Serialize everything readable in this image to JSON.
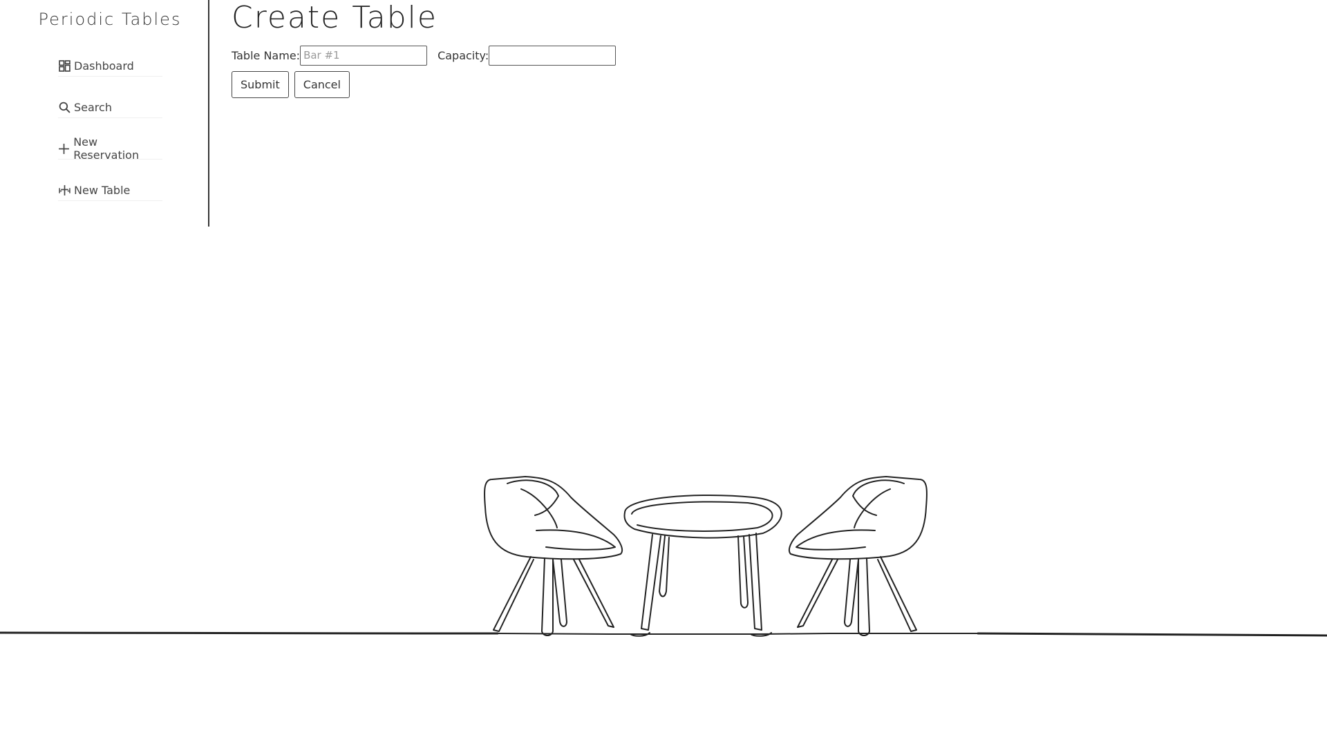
{
  "sidebar": {
    "brand": "Periodic Tables",
    "items": [
      {
        "label": "Dashboard",
        "icon": "dashboard-icon"
      },
      {
        "label": "Search",
        "icon": "search-icon"
      },
      {
        "label": "New Reservation",
        "icon": "plus-icon"
      },
      {
        "label": "New Table",
        "icon": "table-icon"
      }
    ]
  },
  "main": {
    "title": "Create Table",
    "form": {
      "table_name_label": "Table Name:",
      "table_name_value": "",
      "table_name_placeholder": "Bar #1",
      "capacity_label": "Capacity:",
      "capacity_value": "",
      "capacity_placeholder": ""
    },
    "buttons": {
      "submit": "Submit",
      "cancel": "Cancel"
    }
  },
  "colors": {
    "text": "#333333",
    "border": "#444444",
    "background": "#ffffff"
  }
}
